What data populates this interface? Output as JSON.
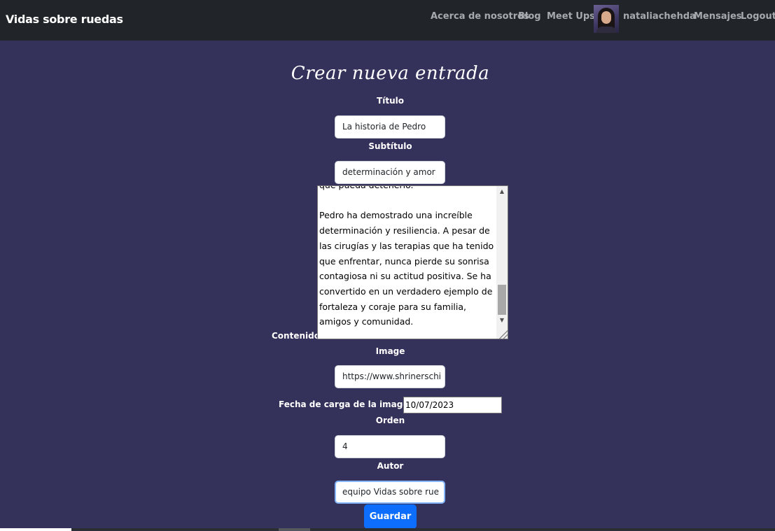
{
  "navbar": {
    "brand": "Vidas sobre ruedas",
    "links": {
      "about": "Acerca de nosotros",
      "blog": "Blog",
      "meetups": "Meet Ups!",
      "username": "nataliachehda",
      "messages": "Mensajes",
      "logout": "Logout"
    }
  },
  "form": {
    "title": "Crear nueva entrada",
    "titulo_label": "Título",
    "titulo_value": "La historia de Pedro",
    "subtitulo_label": "Subtítulo",
    "subtitulo_value": "determinación y amor",
    "contenido_label": "Contenido",
    "contenido_value": "que pueda detenerlo.\n\nPedro ha demostrado una increíble determinación y resiliencia. A pesar de las cirugías y las terapias que ha tenido que enfrentar, nunca pierde su sonrisa contagiosa ni su actitud positiva. Se ha convertido en un verdadero ejemplo de fortaleza y coraje para su familia, amigos y comunidad.",
    "image_label": "Image",
    "image_value": "https://www.shrinerschi",
    "fecha_label": "Fecha de carga de la imagen",
    "fecha_value": "10/07/2023",
    "orden_label": "Orden",
    "orden_value": "4",
    "autor_label": "Autor",
    "autor_value": "equipo Vidas sobre rue",
    "save_label": "Guardar"
  },
  "icons": {
    "scroll_up": "arrow-up-icon",
    "scroll_down": "arrow-down-icon",
    "resize": "resize-grip-icon"
  },
  "colors": {
    "background": "#34315a",
    "navbar": "#212529",
    "button": "#0d6efd"
  }
}
